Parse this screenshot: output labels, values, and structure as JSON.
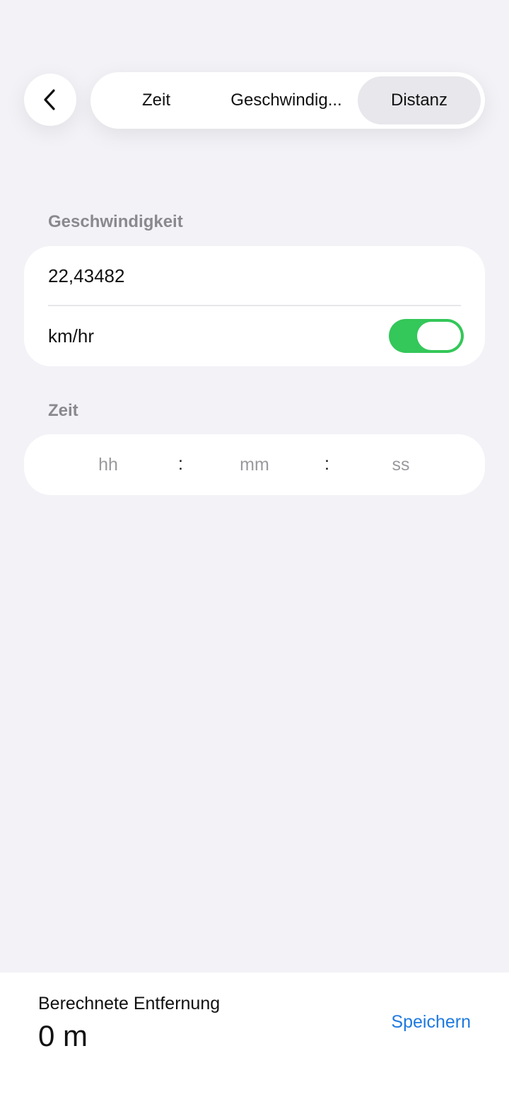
{
  "nav": {
    "back_icon": "chevron-left-icon",
    "tabs": [
      {
        "label": "Zeit",
        "selected": false
      },
      {
        "label": "Geschwindig...",
        "selected": false
      },
      {
        "label": "Distanz",
        "selected": true
      }
    ]
  },
  "speed": {
    "section_label": "Geschwindigkeit",
    "value": "22,43482",
    "unit": "km/hr",
    "unit_toggle_on": true,
    "toggle_color": "#34c759"
  },
  "time": {
    "section_label": "Zeit",
    "hours_placeholder": "hh",
    "minutes_placeholder": "mm",
    "seconds_placeholder": "ss",
    "separator": ":"
  },
  "result": {
    "label": "Berechnete Entfernung",
    "value": "0 m",
    "save_label": "Speichern",
    "accent_color": "#1f7ae0"
  }
}
